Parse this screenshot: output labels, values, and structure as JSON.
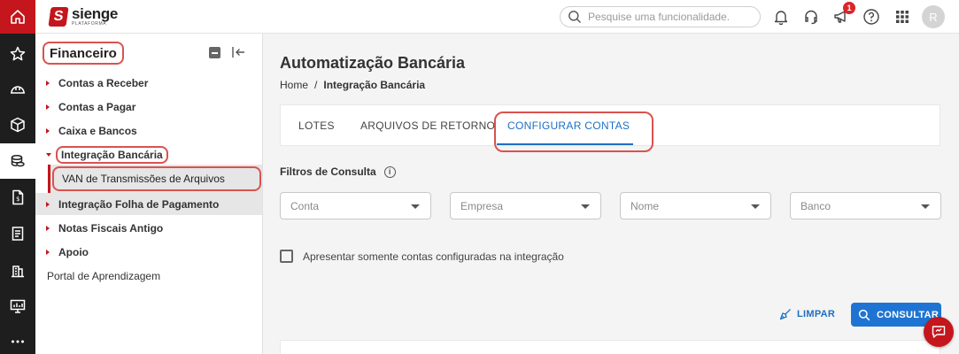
{
  "brand": {
    "name": "sienge",
    "subtitle": "PLATAFORMA",
    "logo_letter": "S",
    "accent_color": "#c4161c"
  },
  "rail": {
    "items": [
      {
        "icon": "home-icon"
      },
      {
        "icon": "star-icon"
      },
      {
        "icon": "helmet-icon"
      },
      {
        "icon": "box-icon"
      },
      {
        "icon": "coins-icon",
        "active": true
      },
      {
        "icon": "document-icon"
      },
      {
        "icon": "list-document-icon"
      },
      {
        "icon": "building-icon"
      },
      {
        "icon": "monitor-icon"
      },
      {
        "icon": "more-icon"
      }
    ]
  },
  "header": {
    "search_placeholder": "Pesquise uma funcionalidade.",
    "notification_count": "1",
    "avatar_initial": "R"
  },
  "sidebar": {
    "title": "Financeiro",
    "items": [
      {
        "label": "Contas a Receber"
      },
      {
        "label": "Contas a Pagar"
      },
      {
        "label": "Caixa e Bancos"
      },
      {
        "label": "Integração Bancária"
      },
      {
        "label": "Integração Folha de Pagamento"
      },
      {
        "label": "Notas Fiscais Antigo"
      },
      {
        "label": "Apoio"
      },
      {
        "label": "Portal de Aprendizagem"
      }
    ],
    "subitem": {
      "label": "VAN de Transmissões de Arquivos"
    }
  },
  "main": {
    "title": "Automatização Bancária",
    "breadcrumb": {
      "home": "Home",
      "separator": "/",
      "current": "Integração Bancária"
    },
    "tabs": [
      {
        "label": "LOTES"
      },
      {
        "label": "ARQUIVOS DE RETORNO"
      },
      {
        "label": "CONFIGURAR CONTAS",
        "active": true
      }
    ],
    "filters_label": "Filtros de Consulta",
    "info_glyph": "i",
    "selects": [
      {
        "placeholder": "Conta"
      },
      {
        "placeholder": "Empresa"
      },
      {
        "placeholder": "Nome"
      },
      {
        "placeholder": "Banco"
      }
    ],
    "checkbox_label": "Apresentar somente contas configuradas na integração",
    "checkbox_checked": false,
    "clear_label": "LIMPAR",
    "search_label": "CONSULTAR",
    "link_color": "#1e6fc2",
    "highlight_color": "#d9534f"
  }
}
